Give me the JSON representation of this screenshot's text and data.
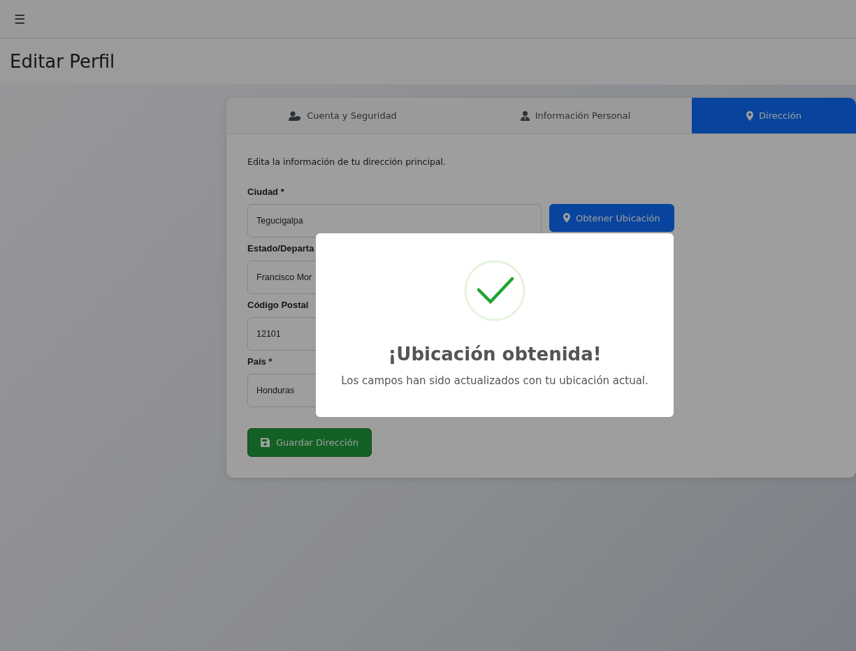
{
  "topbar": {
    "menu_icon": "☰"
  },
  "page_title": "Editar Perfil",
  "tabs": [
    {
      "label": "Cuenta y Seguridad",
      "kind": "account",
      "selected": false
    },
    {
      "label": "Información Personal",
      "kind": "personal",
      "selected": false
    },
    {
      "label": "Dirección",
      "kind": "address",
      "selected": true
    }
  ],
  "intro": "Edita la información de tu dirección principal.",
  "fields": [
    {
      "label": "Ciudad *",
      "value": "Tegucigalpa",
      "action": "Obtener Ubicación"
    },
    {
      "label": "Estado/Departa",
      "value": "Francisco Mor"
    },
    {
      "label": "Código Postal",
      "value": "12101"
    },
    {
      "label": "País *",
      "value": "Honduras"
    }
  ],
  "save_button": "Guardar Dirección",
  "dialog": {
    "title": "¡Ubicación obtenida!",
    "message": "Los campos han sido actualizados con tu ubicación actual."
  }
}
